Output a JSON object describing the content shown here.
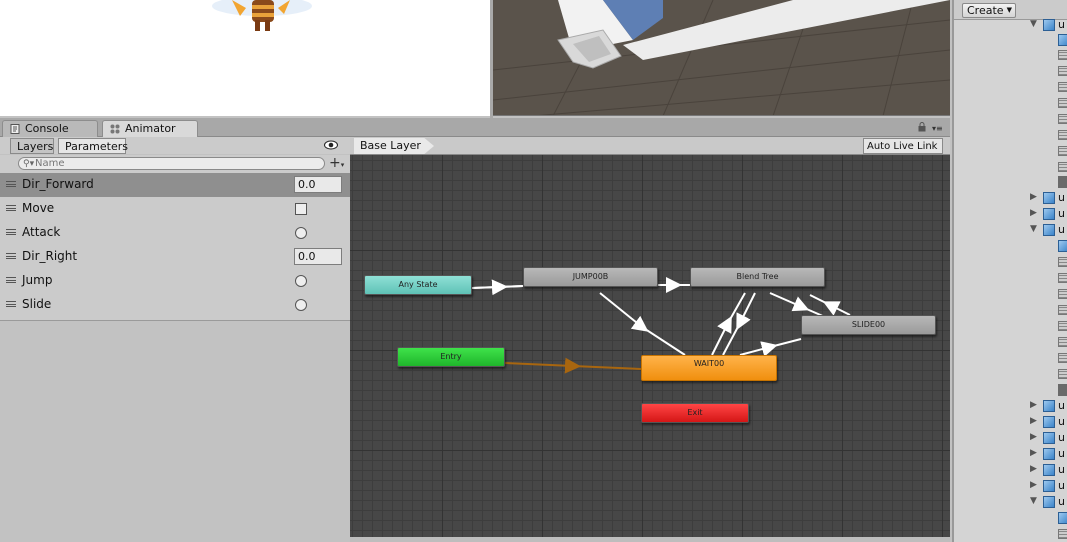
{
  "tabs": {
    "console": "Console",
    "animator": "Animator"
  },
  "left_panel": {
    "tabs": {
      "layers": "Layers",
      "parameters": "Parameters"
    },
    "search_placeholder": "Name",
    "parameters": [
      {
        "name": "Dir_Forward",
        "type": "float",
        "value": "0.0",
        "selected": true
      },
      {
        "name": "Move",
        "type": "bool"
      },
      {
        "name": "Attack",
        "type": "trigger"
      },
      {
        "name": "Dir_Right",
        "type": "float",
        "value": "0.0"
      },
      {
        "name": "Jump",
        "type": "trigger"
      },
      {
        "name": "Slide",
        "type": "trigger"
      }
    ]
  },
  "graph": {
    "breadcrumb": "Base Layer",
    "auto_live_link": "Auto Live Link",
    "nodes": {
      "any_state": "Any State",
      "jump": "JUMP00B",
      "blend_tree": "Blend Tree",
      "slide": "SLIDE00",
      "entry": "Entry",
      "wait": "WAIT00",
      "exit": "Exit"
    }
  },
  "right_col": {
    "create": "Create",
    "item_label": "u"
  },
  "colors": {
    "any_state": "#5fc2b6",
    "entry": "#1fb52b",
    "default_state": "#f08f0e",
    "exit": "#d41616",
    "entry_transition": "#a8660f"
  },
  "icons": [
    "console-icon",
    "animator-icon",
    "lock-icon",
    "menu-icon",
    "eye-icon",
    "search-icon",
    "plus-icon",
    "cube-icon",
    "grid-icon"
  ]
}
